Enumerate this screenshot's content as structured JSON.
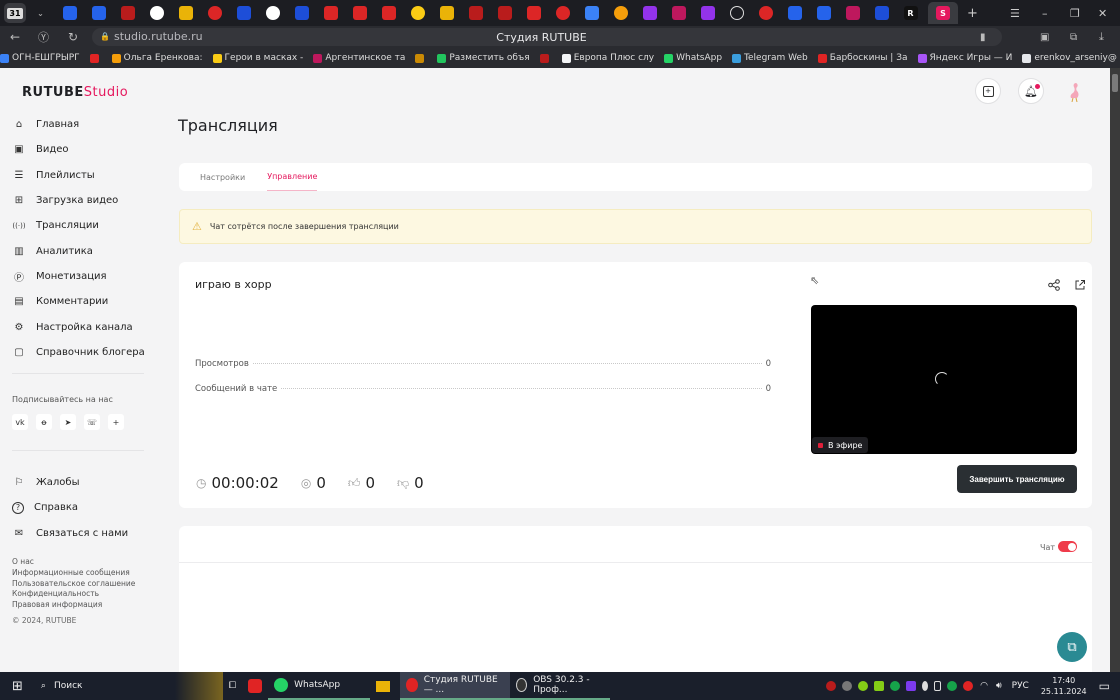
{
  "browser": {
    "tab_count_badge": "31",
    "active_tab_icon": "S",
    "new_tab": "+",
    "url": "studio.rutube.ru",
    "title": "Студия RUTUBE",
    "bookmarks": [
      {
        "label": "ОГН-ЕШГРЫРГ",
        "color": "#3b82f6"
      },
      {
        "label": "",
        "color": "#e02424"
      },
      {
        "label": "Ольга Еренкова:",
        "color": "#f59e0b"
      },
      {
        "label": "Герои в масках -",
        "color": "#facc15"
      },
      {
        "label": "Аргентинское та",
        "color": "#be185d"
      },
      {
        "label": "",
        "color": "#ca8a04"
      },
      {
        "label": "Разместить объя",
        "color": "#22c55e"
      },
      {
        "label": "",
        "color": "#b91c1c"
      },
      {
        "label": "Европа Плюс слу",
        "color": "#f3f4f6"
      },
      {
        "label": "WhatsApp",
        "color": "#25d366"
      },
      {
        "label": "Telegram Web",
        "color": "#3b9ede"
      },
      {
        "label": "Барбоскины | За",
        "color": "#e02424"
      },
      {
        "label": "Яндекс Игры — И",
        "color": "#a855f7"
      },
      {
        "label": "erenkov_arseniy@",
        "color": "#e5e7eb"
      }
    ],
    "more": "»"
  },
  "app": {
    "logo_main": "RUTUBE",
    "logo_sub": "Studio",
    "nav": [
      {
        "label": "Главная",
        "icon": "home-icon"
      },
      {
        "label": "Видео",
        "icon": "video-icon"
      },
      {
        "label": "Плейлисты",
        "icon": "playlist-icon"
      },
      {
        "label": "Загрузка видео",
        "icon": "upload-icon"
      },
      {
        "label": "Трансляции",
        "icon": "broadcast-icon"
      },
      {
        "label": "Аналитика",
        "icon": "analytics-icon"
      },
      {
        "label": "Монетизация",
        "icon": "monetization-icon"
      },
      {
        "label": "Комментарии",
        "icon": "comments-icon"
      },
      {
        "label": "Настройка канала",
        "icon": "settings-icon"
      },
      {
        "label": "Справочник блогера",
        "icon": "guide-icon"
      }
    ],
    "follow_label": "Подписывайтесь на нас",
    "socials": [
      {
        "name": "vk",
        "glyph": "vk"
      },
      {
        "name": "ok",
        "glyph": "ꝋ"
      },
      {
        "name": "telegram",
        "glyph": "➤"
      },
      {
        "name": "viber",
        "glyph": "☏"
      },
      {
        "name": "more",
        "glyph": "+"
      }
    ],
    "nav2": [
      {
        "label": "Жалобы",
        "icon": "flag-icon"
      },
      {
        "label": "Справка",
        "icon": "help-icon"
      },
      {
        "label": "Связаться с нами",
        "icon": "mail-icon"
      }
    ],
    "footer_links": [
      "О нас",
      "Информационные сообщения",
      "Пользовательское соглашение",
      "Конфиденциальность",
      "Правовая информация"
    ],
    "copyright": "© 2024, RUTUBE"
  },
  "main": {
    "page_title": "Трансляция",
    "tabs": [
      {
        "label": "Настройки",
        "active": false
      },
      {
        "label": "Управление",
        "active": true
      }
    ],
    "warning": "Чат сотрётся после завершения трансляции",
    "stream": {
      "title": "играю в хорр",
      "stats": [
        {
          "label": "Просмотров",
          "value": "0"
        },
        {
          "label": "Сообщений в чате",
          "value": "0"
        }
      ],
      "duration": "00:00:02",
      "viewers": "0",
      "likes": "0",
      "dislikes": "0",
      "live_badge": "В эфире",
      "end_button": "Завершить трансляцию"
    },
    "chat": {
      "label": "Чат",
      "enabled": true
    }
  },
  "taskbar": {
    "search": "Поиск",
    "apps": [
      {
        "label": "WhatsApp",
        "color": "#25d366"
      },
      {
        "label": "Студия RUTUBE — ...",
        "color": "#e02424"
      },
      {
        "label": "OBS 30.2.3 - Проф...",
        "color": "#333"
      }
    ],
    "lang": "РУС",
    "time": "17:40",
    "date": "25.11.2024"
  }
}
